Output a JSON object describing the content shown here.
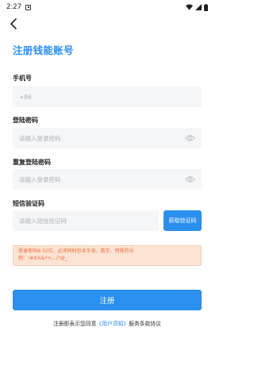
{
  "status": {
    "time": "2:27"
  },
  "header": {
    "title": "注册钱能账号"
  },
  "phone": {
    "label": "手机号",
    "prefix": "+86",
    "value": ""
  },
  "password": {
    "label": "登陆密码",
    "placeholder": "请输入登录密码"
  },
  "confirm_password": {
    "label": "重复登陆密码",
    "placeholder": "请输入登录密码"
  },
  "sms": {
    "label": "短信验证码",
    "placeholder": "请输入短信验证码",
    "button": "获取验证码"
  },
  "notice": {
    "line1": "登录密码8-32位，必须同时包含字母、数字、特殊符号",
    "line2": "例：!#$%&*+,-./?@_"
  },
  "register": {
    "label": "注册"
  },
  "agreement": {
    "prefix": "注册即表示您同意",
    "link": "《用户须知》",
    "suffix": "服务条款协议"
  },
  "colors": {
    "accent": "#2b8ff0",
    "warning_bg": "#fde3d3",
    "warning_text": "#ef6b3b",
    "input_bg": "#f5f6f8"
  }
}
